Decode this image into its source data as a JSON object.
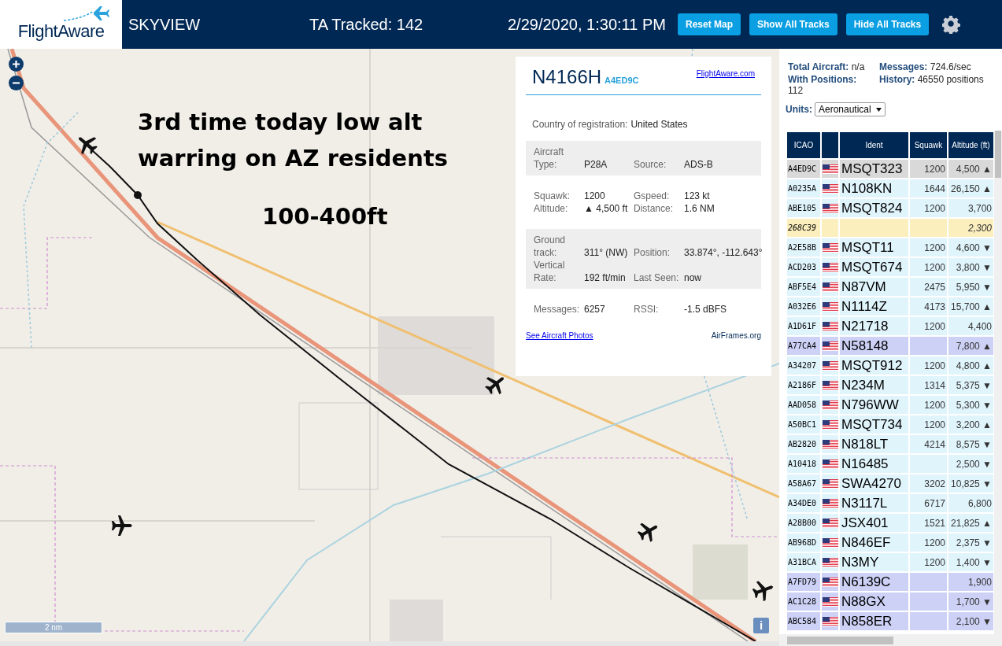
{
  "header": {
    "logo": "FlightAware",
    "title": "SKYVIEW",
    "tracked": "TA Tracked: 142",
    "datetime": "2/29/2020, 1:30:11 PM",
    "buttons": [
      "Reset Map",
      "Show All Tracks",
      "Hide All Tracks"
    ]
  },
  "map": {
    "kind": "picture",
    "annotation_lines": [
      "3rd time today low alt",
      "warring on AZ residents",
      "100-400ft"
    ],
    "scale": "2 nm",
    "info_button": "i"
  },
  "popup": {
    "registration": "N4166H",
    "icao": "A4ED9C",
    "link": "FlightAware.com",
    "country_label": "Country of registration:",
    "country": "United States",
    "sections": [
      {
        "shaded": true,
        "fields": [
          {
            "label": "Aircraft Type:",
            "value": "P28A"
          },
          {
            "label": "Source:",
            "value": "ADS-B"
          }
        ]
      },
      {
        "shaded": false,
        "fields": [
          {
            "label": "Squawk:",
            "value": "1200"
          },
          {
            "label": "Gspeed:",
            "value": "123 kt"
          },
          {
            "label": "Altitude:",
            "value": "▲ 4,500 ft"
          },
          {
            "label": "Distance:",
            "value": "1.6 NM"
          }
        ]
      },
      {
        "shaded": true,
        "fields": [
          {
            "label": "Ground track:",
            "value": "311° (NW)"
          },
          {
            "label": "Position:",
            "value": "33.874°, -112.643°"
          },
          {
            "label": "Vertical Rate:",
            "value": "192 ft/min"
          },
          {
            "label": "Last Seen:",
            "value": "now"
          }
        ]
      },
      {
        "shaded": false,
        "fields": [
          {
            "label": "Messages:",
            "value": "6257"
          },
          {
            "label": "RSSI:",
            "value": "-1.5 dBFS"
          }
        ]
      }
    ],
    "photos_link": "See Aircraft Photos",
    "airframes_link": "AirFrames.org"
  },
  "stats": [
    {
      "label": "Total Aircraft:",
      "value": "n/a"
    },
    {
      "label": "Messages:",
      "value": "724.6/sec"
    },
    {
      "label": "With Positions:",
      "value": "112"
    },
    {
      "label": "History:",
      "value": "46550 positions"
    }
  ],
  "units": {
    "label": "Units:",
    "value": "Aeronautical"
  },
  "table": {
    "columns": [
      "ICAO",
      "Ident",
      "Squawk",
      "Altitude (ft)"
    ],
    "rows": [
      {
        "icao": "A4ED9C",
        "flag": true,
        "ident": "MSQT323",
        "squawk": "1200",
        "altitude": "4,500 ▲",
        "kind": "adsb",
        "selected": true
      },
      {
        "icao": "A0235A",
        "flag": true,
        "ident": "N108KN",
        "squawk": "1644",
        "altitude": "26,150 ▲",
        "kind": "adsb",
        "selected": false
      },
      {
        "icao": "ABE105",
        "flag": true,
        "ident": "MSQT824",
        "squawk": "1200",
        "altitude": "3,700",
        "kind": "adsb",
        "selected": false
      },
      {
        "icao": "268C39",
        "flag": false,
        "altitude": "2,300",
        "kind": "other",
        "selected": false
      },
      {
        "icao": "A2E58B",
        "flag": true,
        "ident": "MSQT11",
        "squawk": "1200",
        "altitude": "4,600 ▼",
        "kind": "adsb",
        "selected": false
      },
      {
        "icao": "ACD203",
        "flag": true,
        "ident": "MSQT674",
        "squawk": "1200",
        "altitude": "3,800 ▼",
        "kind": "adsb",
        "selected": false
      },
      {
        "icao": "ABF5E4",
        "flag": true,
        "ident": "N87VM",
        "squawk": "2475",
        "altitude": "5,950 ▼",
        "kind": "adsb",
        "selected": false
      },
      {
        "icao": "A032E6",
        "flag": true,
        "ident": "N1114Z",
        "squawk": "4173",
        "altitude": "15,700 ▲",
        "kind": "adsb",
        "selected": false
      },
      {
        "icao": "A1D61F",
        "flag": true,
        "ident": "N21718",
        "squawk": "1200",
        "altitude": "4,400",
        "kind": "adsb",
        "selected": false
      },
      {
        "icao": "A77CA4",
        "flag": true,
        "ident": "N58148",
        "altitude": "7,800 ▲",
        "kind": "mlat",
        "selected": false
      },
      {
        "icao": "A34207",
        "flag": true,
        "ident": "MSQT912",
        "squawk": "1200",
        "altitude": "4,800 ▲",
        "kind": "adsb",
        "selected": false
      },
      {
        "icao": "A2186F",
        "flag": true,
        "ident": "N234M",
        "squawk": "1314",
        "altitude": "5,375 ▼",
        "kind": "adsb",
        "selected": false
      },
      {
        "icao": "AAD058",
        "flag": true,
        "ident": "N796WW",
        "squawk": "1200",
        "altitude": "5,300 ▼",
        "kind": "adsb",
        "selected": false
      },
      {
        "icao": "A50BC1",
        "flag": true,
        "ident": "MSQT734",
        "squawk": "1200",
        "altitude": "3,200 ▲",
        "kind": "adsb",
        "selected": false
      },
      {
        "icao": "AB2820",
        "flag": true,
        "ident": "N818LT",
        "squawk": "4214",
        "altitude": "8,575 ▼",
        "kind": "adsb",
        "selected": false
      },
      {
        "icao": "A10418",
        "flag": true,
        "ident": "N16485",
        "altitude": "2,500 ▼",
        "kind": "adsb",
        "selected": false
      },
      {
        "icao": "A58A67",
        "flag": true,
        "ident": "SWA4270",
        "squawk": "3202",
        "altitude": "10,825 ▼",
        "kind": "adsb",
        "selected": false
      },
      {
        "icao": "A34DE0",
        "flag": true,
        "ident": "N3117L",
        "squawk": "6717",
        "altitude": "6,800",
        "kind": "adsb",
        "selected": false
      },
      {
        "icao": "A28B00",
        "flag": true,
        "ident": "JSX401",
        "squawk": "1521",
        "altitude": "21,825 ▲",
        "kind": "adsb",
        "selected": false
      },
      {
        "icao": "AB968D",
        "flag": true,
        "ident": "N846EF",
        "squawk": "1200",
        "altitude": "2,375 ▼",
        "kind": "adsb",
        "selected": false
      },
      {
        "icao": "A31BCA",
        "flag": true,
        "ident": "N3MY",
        "squawk": "1200",
        "altitude": "1,400 ▼",
        "kind": "adsb",
        "selected": false
      },
      {
        "icao": "A7FD79",
        "flag": true,
        "ident": "N6139C",
        "altitude": "1,900",
        "kind": "mlat",
        "selected": false
      },
      {
        "icao": "AC1C28",
        "flag": true,
        "ident": "N88GX",
        "altitude": "1,700 ▼",
        "kind": "mlat",
        "selected": false
      },
      {
        "icao": "ABC584",
        "flag": true,
        "ident": "N858ER",
        "altitude": "2,100 ▼",
        "kind": "mlat",
        "selected": false
      }
    ]
  }
}
